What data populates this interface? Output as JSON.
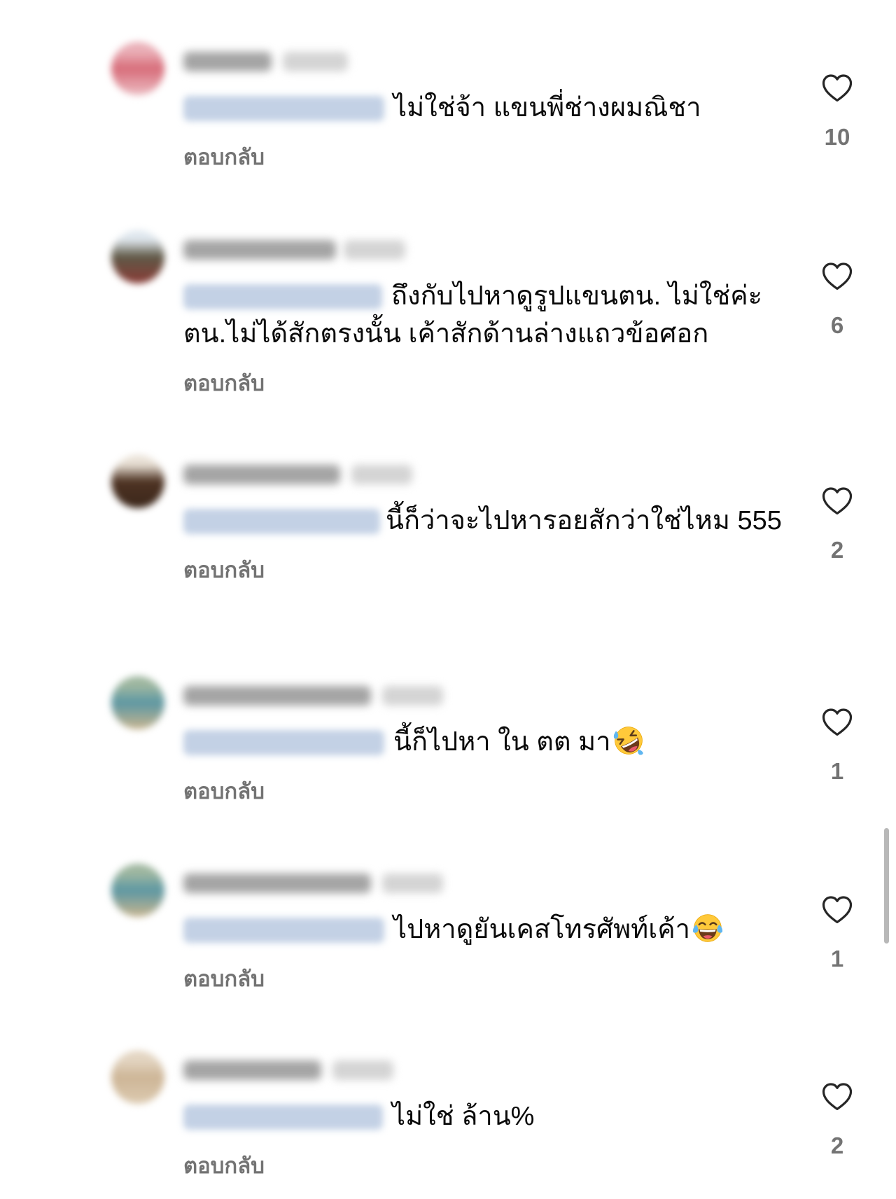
{
  "comments": [
    {
      "text": "ไม่ใช่จ้า แขนพี่ช่างผมณิชา",
      "reply_label": "ตอบกลับ",
      "likes": "10",
      "avatar_colors": [
        "#eab0b8",
        "#d76c79",
        "#ecbdc3"
      ]
    },
    {
      "text": "ถึงกับไปหาดูรูปแขนตน. ไม่ใช่ค่ะ ตน.ไม่ได้สักตรงนั้น เค้าสักด้านล่างแถวข้อศอก",
      "reply_label": "ตอบกลับ",
      "likes": "6",
      "avatar_colors": [
        "#dfe7ee",
        "#5e5846",
        "#8a3b36"
      ]
    },
    {
      "text": "นี้ก็ว่าจะไปหารอยสักว่าใช่ไหม 555",
      "reply_label": "ตอบกลับ",
      "likes": "2",
      "avatar_colors": [
        "#e9e1d6",
        "#4d3222",
        "#3b271b"
      ]
    },
    {
      "text": "นี้ก็ไปหา ใน ตต มา",
      "emoji": "rolling-on-the-floor-laughing",
      "reply_label": "ตอบกลับ",
      "likes": "1",
      "avatar_colors": [
        "#9fb7a0",
        "#5c97a3",
        "#c9b58e"
      ]
    },
    {
      "text": "ไปหาดูยันเคสโทรศัพท์เค้า",
      "emoji": "face-with-tears-of-joy",
      "reply_label": "ตอบกลับ",
      "likes": "1",
      "avatar_colors": [
        "#9fb7a0",
        "#5c97a3",
        "#c9b58e"
      ]
    },
    {
      "text": "ไม่ใช่ ล้าน%",
      "reply_label": "ตอบกลับ",
      "likes": "2",
      "avatar_colors": [
        "#e3d5c2",
        "#cdb596",
        "#dccab0"
      ]
    }
  ]
}
